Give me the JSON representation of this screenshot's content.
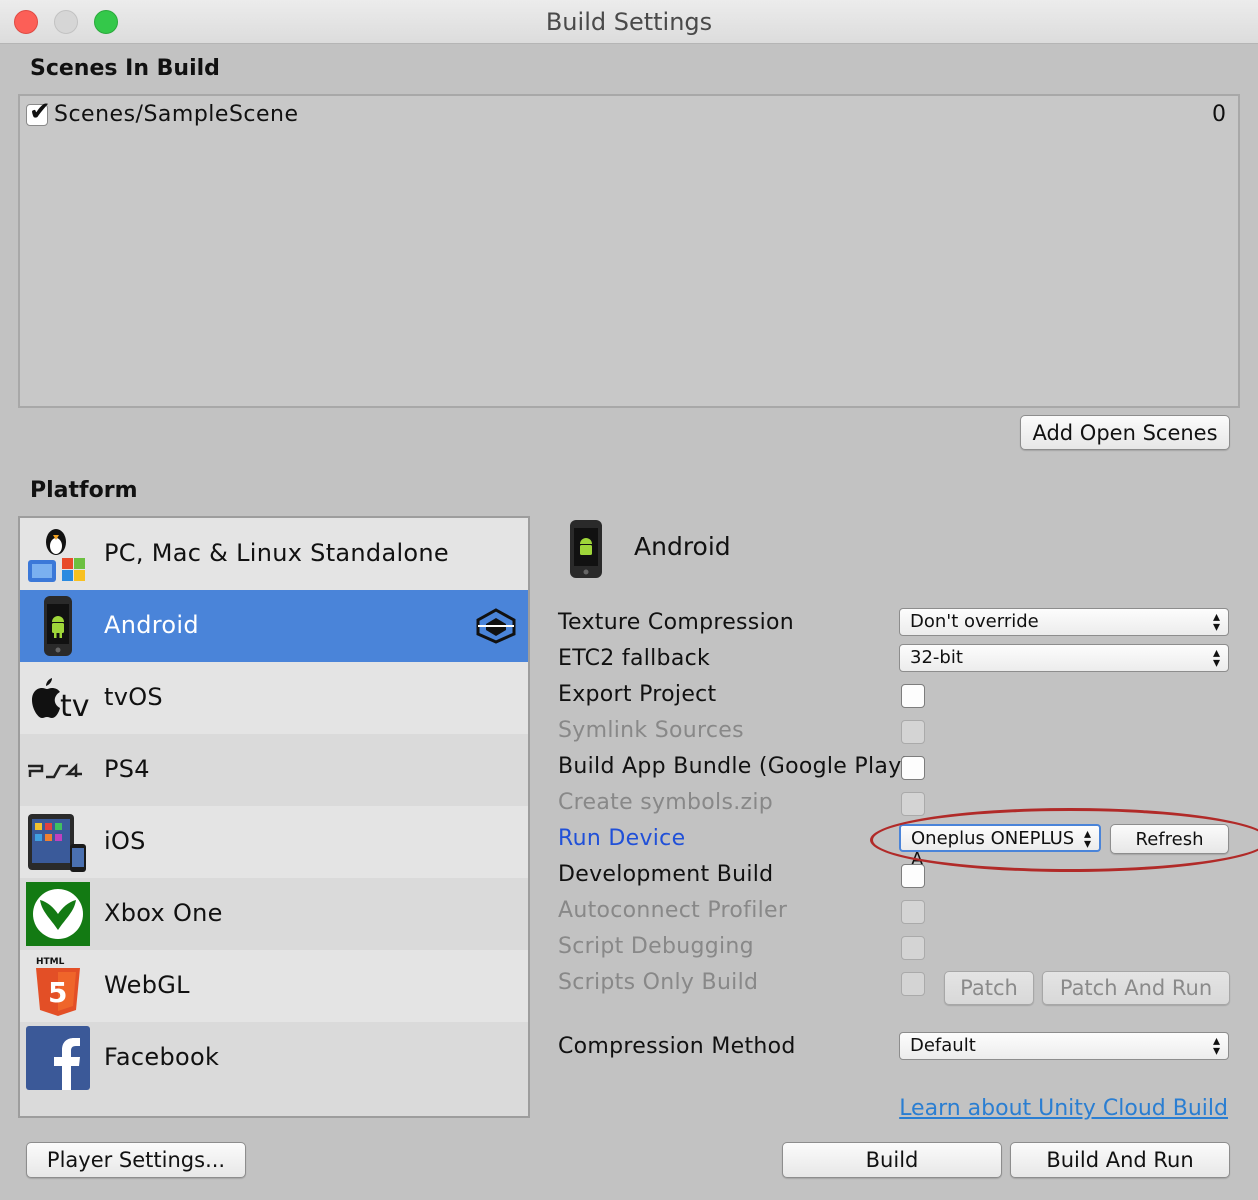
{
  "window": {
    "title": "Build Settings"
  },
  "scenes": {
    "title": "Scenes In Build",
    "items": [
      {
        "checked": true,
        "name": "Scenes/SampleScene",
        "index": "0"
      }
    ],
    "add_open_scenes_label": "Add Open Scenes"
  },
  "platform": {
    "title": "Platform",
    "items": [
      {
        "label": "PC, Mac & Linux Standalone",
        "icon": "pc-mac-linux-icon"
      },
      {
        "label": "Android",
        "icon": "android-phone-icon",
        "selected": true
      },
      {
        "label": "tvOS",
        "icon": "apple-tv-icon"
      },
      {
        "label": "PS4",
        "icon": "ps4-icon"
      },
      {
        "label": "iOS",
        "icon": "ios-devices-icon"
      },
      {
        "label": "Xbox One",
        "icon": "xbox-icon"
      },
      {
        "label": "WebGL",
        "icon": "html5-icon"
      },
      {
        "label": "Facebook",
        "icon": "facebook-icon"
      }
    ]
  },
  "details": {
    "title": "Android",
    "texture_compression": {
      "label": "Texture Compression",
      "value": "Don't override"
    },
    "etc2_fallback": {
      "label": "ETC2 fallback",
      "value": "32-bit"
    },
    "export_project": {
      "label": "Export Project",
      "checked": false
    },
    "symlink_sources": {
      "label": "Symlink Sources",
      "checked": false
    },
    "build_app_bundle": {
      "label": "Build App Bundle (Google Play)",
      "checked": false
    },
    "create_symbols": {
      "label": "Create symbols.zip",
      "checked": false
    },
    "run_device": {
      "label": "Run Device",
      "value": "Oneplus ONEPLUS A",
      "refresh_label": "Refresh"
    },
    "development_build": {
      "label": "Development Build",
      "checked": false
    },
    "autoconnect_profiler": {
      "label": "Autoconnect Profiler",
      "checked": false
    },
    "script_debugging": {
      "label": "Script Debugging",
      "checked": false
    },
    "scripts_only_build": {
      "label": "Scripts Only Build",
      "checked": false,
      "patch_label": "Patch",
      "patch_run_label": "Patch And Run"
    },
    "compression_method": {
      "label": "Compression Method",
      "value": "Default"
    },
    "cloud_build_link": "Learn about Unity Cloud Build"
  },
  "footer": {
    "player_settings_label": "Player Settings...",
    "build_label": "Build",
    "build_and_run_label": "Build And Run"
  },
  "colors": {
    "selection": "#4a84d9",
    "link": "#2a7ed2",
    "annotation": "#b12a28"
  }
}
